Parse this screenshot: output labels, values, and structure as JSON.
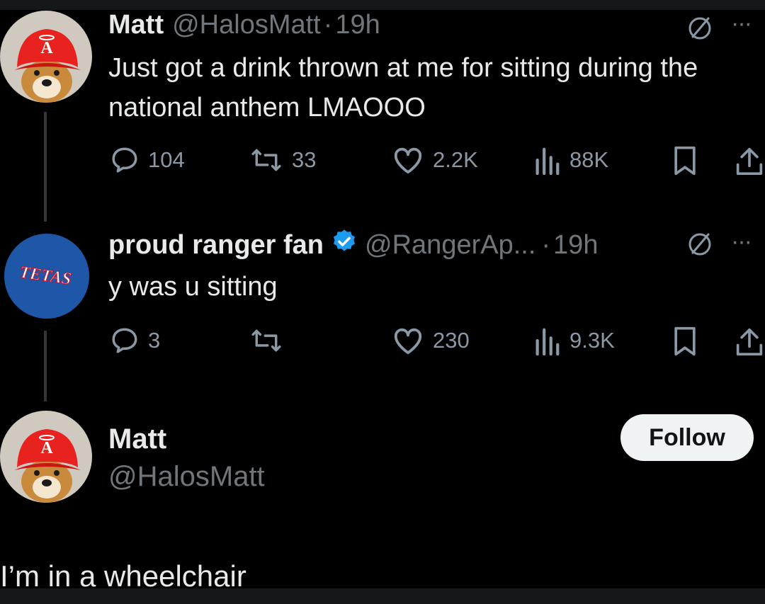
{
  "colors": {
    "background": "#000000",
    "text_primary": "#e7e9ea",
    "text_secondary": "#71767b",
    "verified_blue": "#1d9bf0",
    "follow_button_bg": "#eff3f4",
    "angels_red": "#e8231f",
    "rangers_blue": "#1f57a8"
  },
  "tweets": [
    {
      "avatar_icon": "dog-angels-cap-avatar",
      "name": "Matt",
      "handle": "@HalosMatt",
      "separator": "·",
      "time": "19h",
      "text": "Just got a drink thrown at me for sitting during the national anthem LMAOOO",
      "replies": "104",
      "reposts": "33",
      "likes": "2.2K",
      "views": "88K"
    },
    {
      "avatar_icon": "texas-rangers-logo-avatar",
      "avatar_text": "TETAS",
      "name": "proud ranger fan",
      "handle": "@RangerAp...",
      "separator": "·",
      "time": "19h",
      "text": "y was u sitting",
      "replies": "3",
      "reposts": "",
      "likes": "230",
      "views": "9.3K"
    }
  ],
  "profile": {
    "name": "Matt",
    "handle": "@HalosMatt",
    "follow_label": "Follow"
  },
  "reply_text": "I’m in a wheelchair"
}
